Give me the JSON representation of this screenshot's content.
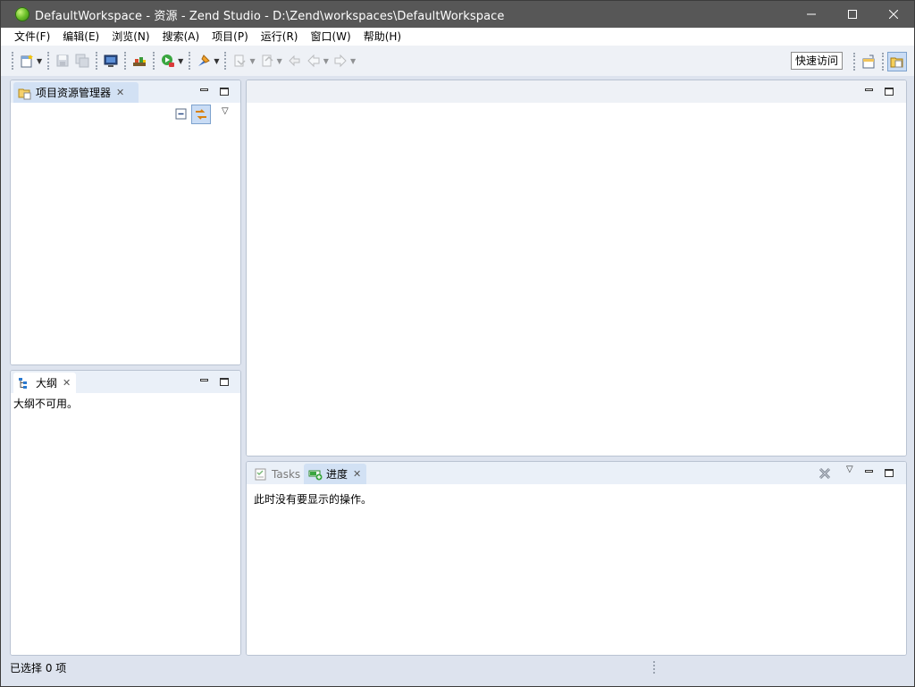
{
  "window": {
    "title": "DefaultWorkspace - 资源 - Zend Studio - D:\\Zend\\workspaces\\DefaultWorkspace",
    "minimize_glyph": "—",
    "maximize_glyph": "☐",
    "close_glyph": "✕"
  },
  "menu": {
    "items": [
      "文件(F)",
      "编辑(E)",
      "浏览(N)",
      "搜索(A)",
      "项目(P)",
      "运行(R)",
      "窗口(W)",
      "帮助(H)"
    ]
  },
  "toolbar": {
    "icons": [
      "new-icon",
      "save-icon",
      "save-all-icon",
      "terminal-icon",
      "build-icon",
      "debug-run-icon",
      "deploy-icon",
      "next-annotation-icon",
      "prev-annotation-icon",
      "last-edit-icon",
      "back-icon",
      "forward-icon"
    ],
    "quick_access_label": "快速访问"
  },
  "panels": {
    "project_explorer": {
      "tab_label": "项目资源管理器",
      "close_glyph": "✕"
    },
    "outline": {
      "tab_label": "大纲",
      "close_glyph": "✕",
      "message": "大纲不可用。"
    },
    "bottom": {
      "tasks_label": "Tasks",
      "progress_label": "进度",
      "close_glyph": "✕",
      "message": "此时没有要显示的操作。"
    }
  },
  "status": {
    "text": "已选择 0 项"
  },
  "colors": {
    "titlebar": "#575757",
    "accent": "#d2e1f4",
    "app_icon": "#6cc02a"
  }
}
